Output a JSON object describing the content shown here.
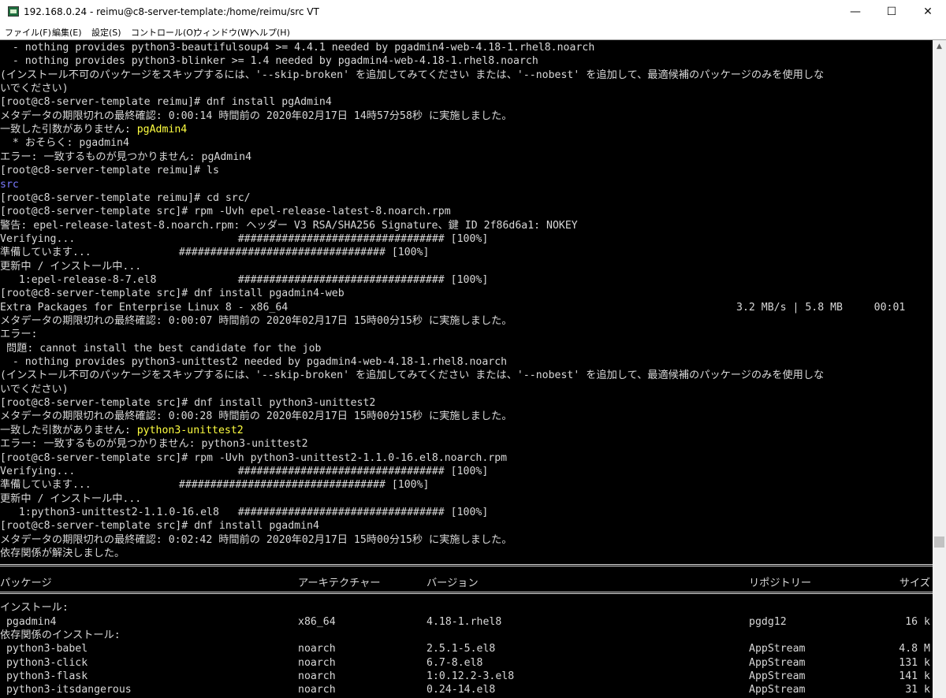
{
  "window": {
    "title": "192.168.0.24 - reimu@c8-server-template:/home/reimu/src VT",
    "app_icon": "teraterm-icon",
    "controls": {
      "minimize": "—",
      "maximize": "☐",
      "close": "✕"
    }
  },
  "menu": [
    {
      "label": "ファイル(F)"
    },
    {
      "label": "編集(E)"
    },
    {
      "label": "設定(S)"
    },
    {
      "label": "コントロール(O)"
    },
    {
      "label": "ウィンドウ(W)"
    },
    {
      "label": "ヘルプ(H)"
    }
  ],
  "colors": {
    "terminal_bg": "#000000",
    "text": "#d8d8d8",
    "highlight": "#ffff40",
    "dir": "#7b7bff",
    "chrome": "#ffffff"
  },
  "terminal": {
    "lines": [
      {
        "segments": [
          {
            "text": "  - nothing provides python3-beautifulsoup4 >= 4.4.1 needed by pgadmin4-web-4.18-1.rhel8.noarch"
          }
        ]
      },
      {
        "segments": [
          {
            "text": "  - nothing provides python3-blinker >= 1.4 needed by pgadmin4-web-4.18-1.rhel8.noarch"
          }
        ]
      },
      {
        "segments": [
          {
            "text": "(インストール不可のパッケージをスキップするには、'--skip-broken' を追加してみてください または、'--nobest' を追加して、最適候補のパッケージのみを使用しな"
          }
        ]
      },
      {
        "segments": [
          {
            "text": "いでください)"
          }
        ]
      },
      {
        "segments": [
          {
            "text": "[root@c8-server-template reimu]# dnf install pgAdmin4"
          }
        ]
      },
      {
        "segments": [
          {
            "text": "メタデータの期限切れの最終確認: 0:00:14 時間前の 2020年02月17日 14時57分58秒 に実施しました。"
          }
        ]
      },
      {
        "segments": [
          {
            "text": "一致した引数がありません: "
          },
          {
            "text": "pgAdmin4",
            "color": "highlight"
          }
        ]
      },
      {
        "segments": [
          {
            "text": "  * おそらく: pgadmin4"
          }
        ]
      },
      {
        "segments": [
          {
            "text": "エラー: 一致するものが見つかりません: pgAdmin4"
          }
        ]
      },
      {
        "segments": [
          {
            "text": "[root@c8-server-template reimu]# ls"
          }
        ]
      },
      {
        "segments": [
          {
            "text": "src",
            "color": "dir"
          }
        ]
      },
      {
        "segments": [
          {
            "text": "[root@c8-server-template reimu]# cd src/"
          }
        ]
      },
      {
        "segments": [
          {
            "text": "[root@c8-server-template src]# rpm -Uvh epel-release-latest-8.noarch.rpm"
          }
        ]
      },
      {
        "segments": [
          {
            "text": "警告: epel-release-latest-8.noarch.rpm: ヘッダー V3 RSA/SHA256 Signature、鍵 ID 2f86d6a1: NOKEY"
          }
        ]
      },
      {
        "segments": [
          {
            "text": "Verifying...                          ################################# [100%]"
          }
        ]
      },
      {
        "segments": [
          {
            "text": "準備しています...              ################################# [100%]"
          }
        ]
      },
      {
        "segments": [
          {
            "text": "更新中 / インストール中..."
          }
        ]
      },
      {
        "segments": [
          {
            "text": "   1:epel-release-8-7.el8             ################################# [100%]"
          }
        ]
      },
      {
        "segments": [
          {
            "text": "[root@c8-server-template src]# dnf install pgadmin4-web"
          }
        ]
      },
      {
        "segments": [
          {
            "text": "Extra Packages for Enterprise Linux 8 - x86_64"
          }
        ],
        "right": "3.2 MB/s | 5.8 MB     00:01"
      },
      {
        "segments": [
          {
            "text": "メタデータの期限切れの最終確認: 0:00:07 時間前の 2020年02月17日 15時00分15秒 に実施しました。"
          }
        ]
      },
      {
        "segments": [
          {
            "text": "エラー:"
          }
        ]
      },
      {
        "segments": [
          {
            "text": " 問題: cannot install the best candidate for the job"
          }
        ]
      },
      {
        "segments": [
          {
            "text": "  - nothing provides python3-unittest2 needed by pgadmin4-web-4.18-1.rhel8.noarch"
          }
        ]
      },
      {
        "segments": [
          {
            "text": "(インストール不可のパッケージをスキップするには、'--skip-broken' を追加してみてください または、'--nobest' を追加して、最適候補のパッケージのみを使用しな"
          }
        ]
      },
      {
        "segments": [
          {
            "text": "いでください)"
          }
        ]
      },
      {
        "segments": [
          {
            "text": "[root@c8-server-template src]# dnf install python3-unittest2"
          }
        ]
      },
      {
        "segments": [
          {
            "text": "メタデータの期限切れの最終確認: 0:00:28 時間前の 2020年02月17日 15時00分15秒 に実施しました。"
          }
        ]
      },
      {
        "segments": [
          {
            "text": "一致した引数がありません: "
          },
          {
            "text": "python3-unittest2",
            "color": "highlight"
          }
        ]
      },
      {
        "segments": [
          {
            "text": "エラー: 一致するものが見つかりません: python3-unittest2"
          }
        ]
      },
      {
        "segments": [
          {
            "text": "[root@c8-server-template src]# rpm -Uvh python3-unittest2-1.1.0-16.el8.noarch.rpm"
          }
        ]
      },
      {
        "segments": [
          {
            "text": "Verifying...                          ################################# [100%]"
          }
        ]
      },
      {
        "segments": [
          {
            "text": "準備しています...              ################################# [100%]"
          }
        ]
      },
      {
        "segments": [
          {
            "text": "更新中 / インストール中..."
          }
        ]
      },
      {
        "segments": [
          {
            "text": "   1:python3-unittest2-1.1.0-16.el8   ################################# [100%]"
          }
        ]
      },
      {
        "segments": [
          {
            "text": "[root@c8-server-template src]# dnf install pgadmin4"
          }
        ]
      },
      {
        "segments": [
          {
            "text": "メタデータの期限切れの最終確認: 0:02:42 時間前の 2020年02月17日 15時00分15秒 に実施しました。"
          }
        ]
      },
      {
        "segments": [
          {
            "text": "依存関係が解決しました。"
          }
        ]
      }
    ],
    "package_table": {
      "headers": {
        "package": "パッケージ",
        "arch": "アーキテクチャー",
        "version": "バージョン",
        "repo": "リポジトリー",
        "size": "サイズ"
      },
      "sections": [
        {
          "label": "インストール:",
          "rows": [
            {
              "package": " pgadmin4",
              "arch": "x86_64",
              "version": "4.18-1.rhel8",
              "repo": "pgdg12",
              "size": "16 k"
            }
          ]
        },
        {
          "label": "依存関係のインストール:",
          "rows": [
            {
              "package": " python3-babel",
              "arch": "noarch",
              "version": "2.5.1-5.el8",
              "repo": "AppStream",
              "size": "4.8 M"
            },
            {
              "package": " python3-click",
              "arch": "noarch",
              "version": "6.7-8.el8",
              "repo": "AppStream",
              "size": "131 k"
            },
            {
              "package": " python3-flask",
              "arch": "noarch",
              "version": "1:0.12.2-3.el8",
              "repo": "AppStream",
              "size": "141 k"
            },
            {
              "package": " python3-itsdangerous",
              "arch": "noarch",
              "version": "0.24-14.el8",
              "repo": "AppStream",
              "size": "31 k"
            }
          ]
        }
      ]
    }
  },
  "scrollbar": {
    "up_arrow": "▲"
  }
}
